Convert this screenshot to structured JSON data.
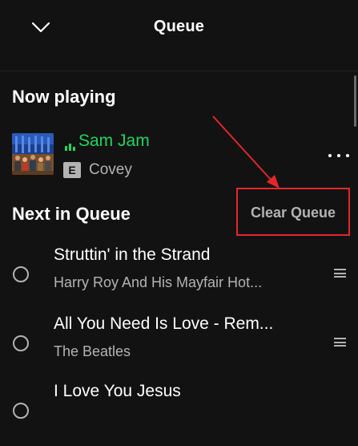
{
  "header": {
    "title": "Queue",
    "collapse_icon": "chevron-down-icon"
  },
  "now_playing": {
    "heading": "Now playing",
    "track": {
      "title": "Sam Jam",
      "artist": "Covey",
      "explicit_badge": "E",
      "title_color": "#1ed760"
    },
    "more_icon": "more-horizontal-icon"
  },
  "next_in_queue": {
    "heading": "Next in Queue",
    "clear_button_label": "Clear Queue",
    "tracks": [
      {
        "title": "Struttin' in the Strand",
        "artist": "Harry Roy And His Mayfair Hot..."
      },
      {
        "title": "All You Need Is Love - Rem...",
        "artist": "The Beatles"
      },
      {
        "title": "I Love You Jesus",
        "artist": ""
      }
    ]
  },
  "colors": {
    "background": "#121212",
    "accent_green": "#1ed760",
    "secondary_text": "#b3b3b3",
    "annotation_red": "#e4262b"
  }
}
